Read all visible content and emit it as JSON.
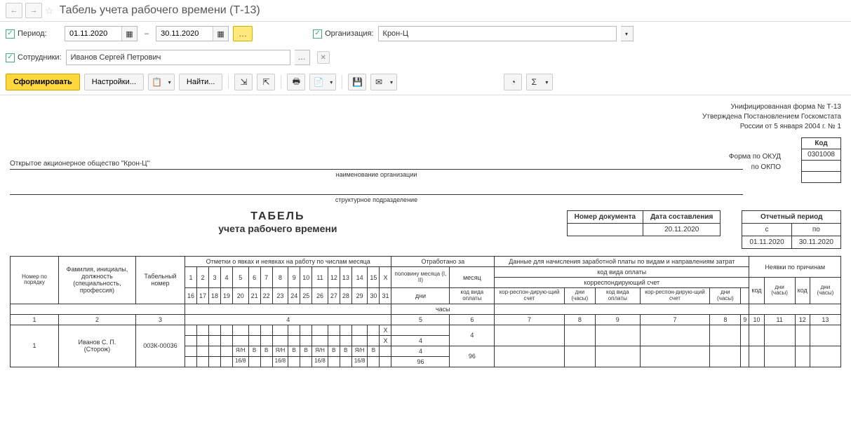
{
  "title": "Табель учета рабочего времени (Т-13)",
  "filters": {
    "period_label": "Период:",
    "date_from": "01.11.2020",
    "date_to": "30.11.2020",
    "org_label": "Организация:",
    "org_value": "Крон-Ц",
    "emp_label": "Сотрудники:",
    "emp_value": "Иванов Сергей Петрович"
  },
  "actions": {
    "generate": "Сформировать",
    "settings": "Настройки...",
    "find": "Найти..."
  },
  "form_header": {
    "line1": "Унифицированная форма № Т-13",
    "line2": "Утверждена Постановлением Госкомстата",
    "line3": "России от 5 января 2004 г. № 1"
  },
  "code_block": {
    "header": "Код",
    "okud_label": "Форма по ОКУД",
    "okud_value": "0301008",
    "okpo_label": "по ОКПО"
  },
  "org_line": {
    "name": "Открытое акционерное общество \"Крон-Ц\"",
    "caption1": "наименование организации",
    "caption2": "структурное подразделение"
  },
  "doc_info": {
    "doc_num_label": "Номер документа",
    "date_label": "Дата составления",
    "date_value": "20.11.2020",
    "period_label": "Отчетный период",
    "from_label": "с",
    "to_label": "по",
    "from_value": "01.11.2020",
    "to_value": "30.11.2020"
  },
  "report_title": {
    "main": "ТАБЕЛЬ",
    "sub": "учета  рабочего времени"
  },
  "headers": {
    "num": "Номер по порядку",
    "fio": "Фамилия, инициалы, должность (специальность, профессия)",
    "tab_num": "Табельный номер",
    "marks": "Отметки о явках и неявках на работу по числам месяца",
    "worked": "Отработано за",
    "half_month": "половину месяца (I, II)",
    "month": "месяц",
    "days": "дни",
    "hours": "часы",
    "payroll": "Данные для начисления заработной платы по видам и направлениям затрат",
    "pay_code": "код вида оплаты",
    "corr_acc": "корреспондирующий счет",
    "code_pay": "код вида оплаты",
    "corr": "кор-респон-дирую-щий счет",
    "days_hours": "дни (часы)",
    "absence": "Неявки по причинам",
    "code": "код"
  },
  "col_nums": [
    "1",
    "2",
    "3",
    "4",
    "5",
    "6",
    "7",
    "8",
    "9",
    "7",
    "8",
    "9",
    "10",
    "11",
    "12",
    "13"
  ],
  "days_row1": [
    "1",
    "2",
    "3",
    "4",
    "5",
    "6",
    "7",
    "8",
    "9",
    "10",
    "11",
    "12",
    "13",
    "14",
    "15",
    "X"
  ],
  "days_row2": [
    "16",
    "17",
    "18",
    "19",
    "20",
    "21",
    "22",
    "23",
    "24",
    "25",
    "26",
    "27",
    "28",
    "29",
    "30",
    "31"
  ],
  "data_row": {
    "num": "1",
    "name": "Иванов С. П.",
    "position": "(Сторож)",
    "tab_num": "003К-00036",
    "r1": [
      "",
      "",
      "",
      "",
      "",
      "",
      "",
      "",
      "",
      "",
      "",
      "",
      "",
      "",
      "",
      "X"
    ],
    "r2": [
      "",
      "",
      "",
      "",
      "",
      "",
      "",
      "",
      "",
      "",
      "",
      "",
      "",
      "",
      "",
      "X"
    ],
    "r3": [
      "",
      "",
      "",
      "",
      "Я/Н",
      "В",
      "В",
      "Я/Н",
      "В",
      "В",
      "Я/Н",
      "В",
      "В",
      "Я/Н",
      "В",
      ""
    ],
    "r4": [
      "",
      "",
      "",
      "",
      "16/8",
      "",
      "",
      "16/8",
      "",
      "",
      "16/8",
      "",
      "",
      "16/8",
      "",
      ""
    ],
    "half1_days": "",
    "half2_days": "4",
    "half1_hours": "4",
    "half2_hours": "96",
    "month_days": "4",
    "month_hours": "96"
  }
}
